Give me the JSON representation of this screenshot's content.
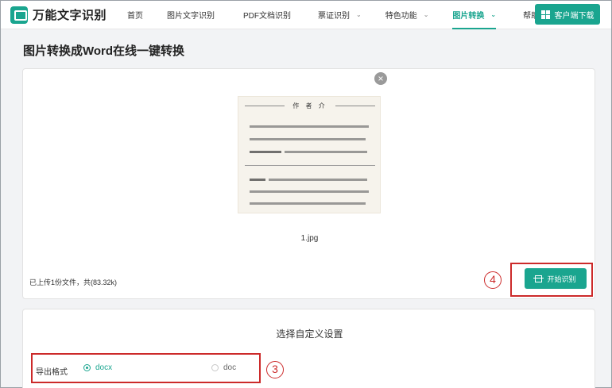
{
  "header": {
    "logo_text": "万能文字识别",
    "nav": [
      {
        "label": "首页",
        "dropdown": false,
        "active": false
      },
      {
        "label": "图片文字识别",
        "dropdown": false,
        "active": false
      },
      {
        "label": "PDF文档识别",
        "dropdown": false,
        "active": false
      },
      {
        "label": "票证识别",
        "dropdown": true,
        "active": false
      },
      {
        "label": "特色功能",
        "dropdown": true,
        "active": false
      },
      {
        "label": "图片转换",
        "dropdown": true,
        "active": true
      },
      {
        "label": "帮助中心",
        "dropdown": false,
        "active": false
      }
    ],
    "download_label": "客户端下载"
  },
  "page_title": "图片转换成Word在线一键转换",
  "upload": {
    "close_glyph": "×",
    "preview_heading": "作 者 介",
    "file_name": "1.jpg",
    "status": "已上传1份文件，共(83.32k)",
    "start_label": "开始识别"
  },
  "settings": {
    "title": "选择自定义设置",
    "export_label": "导出格式",
    "options": [
      {
        "label": "docx",
        "checked": true
      },
      {
        "label": "doc",
        "checked": false
      }
    ]
  },
  "annotations": {
    "step_start": "4",
    "step_format": "3",
    "color": "#cc2a2a"
  },
  "colors": {
    "accent": "#1aa58f",
    "page_bg": "#f2f3f5"
  }
}
